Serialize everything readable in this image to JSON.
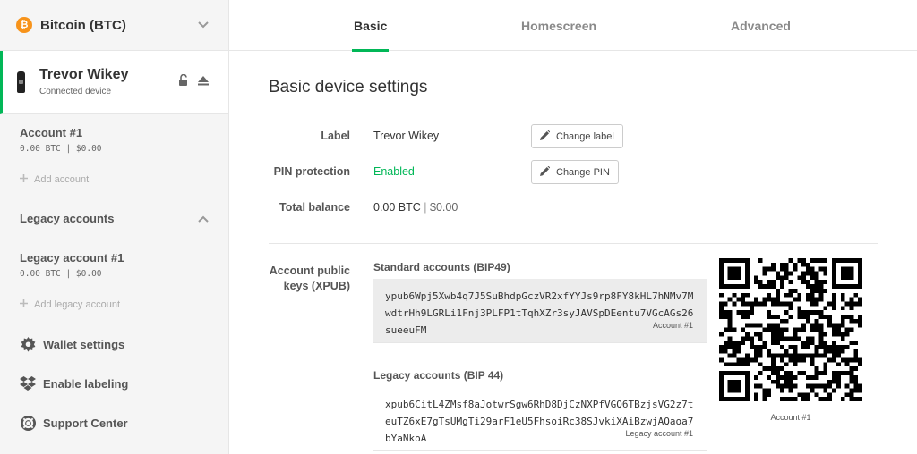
{
  "sidebar": {
    "coin": {
      "logo_symbol": "₿",
      "name": "Bitcoin (BTC)",
      "color": "#f7931a"
    },
    "device": {
      "name": "Trevor Wikey",
      "status": "Connected device"
    },
    "accounts": [
      {
        "title": "Account #1",
        "balance": "0.00 BTC | $0.00"
      }
    ],
    "add_account": "Add account",
    "legacy_section": "Legacy accounts",
    "legacy_accounts": [
      {
        "title": "Legacy account #1",
        "balance": "0.00 BTC | $0.00"
      }
    ],
    "add_legacy_account": "Add legacy account",
    "menu": [
      {
        "label": "Wallet settings",
        "icon": "gear-icon"
      },
      {
        "label": "Enable labeling",
        "icon": "dropbox-icon"
      },
      {
        "label": "Support Center",
        "icon": "lifebuoy-icon"
      }
    ]
  },
  "tabs": [
    {
      "label": "Basic",
      "active": true
    },
    {
      "label": "Homescreen",
      "active": false
    },
    {
      "label": "Advanced",
      "active": false
    }
  ],
  "settings": {
    "title": "Basic device settings",
    "label_key": "Label",
    "label_value": "Trevor Wikey",
    "change_label": "Change label",
    "pin_key": "PIN protection",
    "pin_value": "Enabled",
    "change_pin": "Change PIN",
    "balance_key": "Total balance",
    "balance_btc": "0.00 BTC",
    "balance_sep": "|",
    "balance_usd": "$0.00",
    "xpub_key_line1": "Account public",
    "xpub_key_line2": "keys (XPUB)",
    "standard": {
      "heading": "Standard accounts (BIP49)",
      "key": "ypub6Wpj5Xwb4q7J5SuBhdpGczVR2xfYYJs9rp8FY8kHL7hNMv7MwdtrHh9LGRLi1Fnj3PLFP1tTqhXZr3syJAVSpDEentu7VGcAGs26sueeuFM",
      "account": "Account #1"
    },
    "legacy": {
      "heading": "Legacy accounts (BIP 44)",
      "key": "xpub6CitL4ZMsf8aJotwrSgw6RhD8DjCzNXPfVGQ6TBzjsVG2z7teuTZ6xE7gTsUMgTi29arF1eU5FhsoiRc38SJvkiXAiBzwjAQaoa7bYaNkoA",
      "account": "Legacy account #1"
    },
    "qr_caption": "Account #1"
  },
  "colors": {
    "accent": "#01b757",
    "sidebar_bg": "#f5f5f5",
    "selected_box": "#ececec"
  }
}
